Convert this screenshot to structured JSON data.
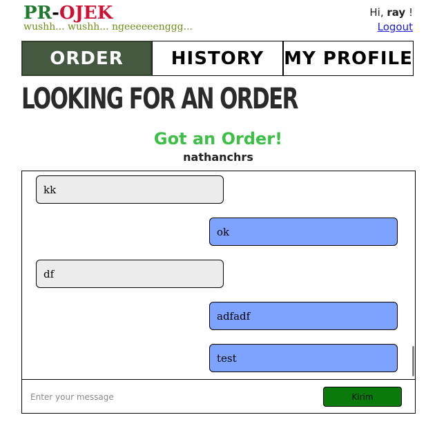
{
  "header": {
    "logo_pr": "PR",
    "logo_dash": "-",
    "logo_ojek": "OJEK",
    "tagline": "wushh... wushh... ngeeeeeenggg...",
    "greeting_prefix": "Hi, ",
    "username": "ray",
    "greeting_suffix": " !",
    "logout_label": "Logout"
  },
  "nav": {
    "order_label": "ORDER",
    "history_label": "HISTORY",
    "profile_label": "MY PROFILE"
  },
  "page": {
    "title": "LOOKING FOR AN ORDER",
    "status": "Got an Order!",
    "customer": "nathanchrs"
  },
  "chat": {
    "messages": [
      {
        "side": "left",
        "text": "kk"
      },
      {
        "side": "right",
        "text": "ok"
      },
      {
        "side": "left",
        "text": "df"
      },
      {
        "side": "right",
        "text": "adfadf"
      },
      {
        "side": "right",
        "text": "test"
      }
    ],
    "input_placeholder": "Enter your message",
    "send_label": "Kirim"
  },
  "colors": {
    "active_tab": "#44593f",
    "status_green": "#3cbf45",
    "incoming_bubble": "#ececec",
    "outgoing_bubble": "#7da3ff",
    "send_button": "#0a7a0a"
  }
}
